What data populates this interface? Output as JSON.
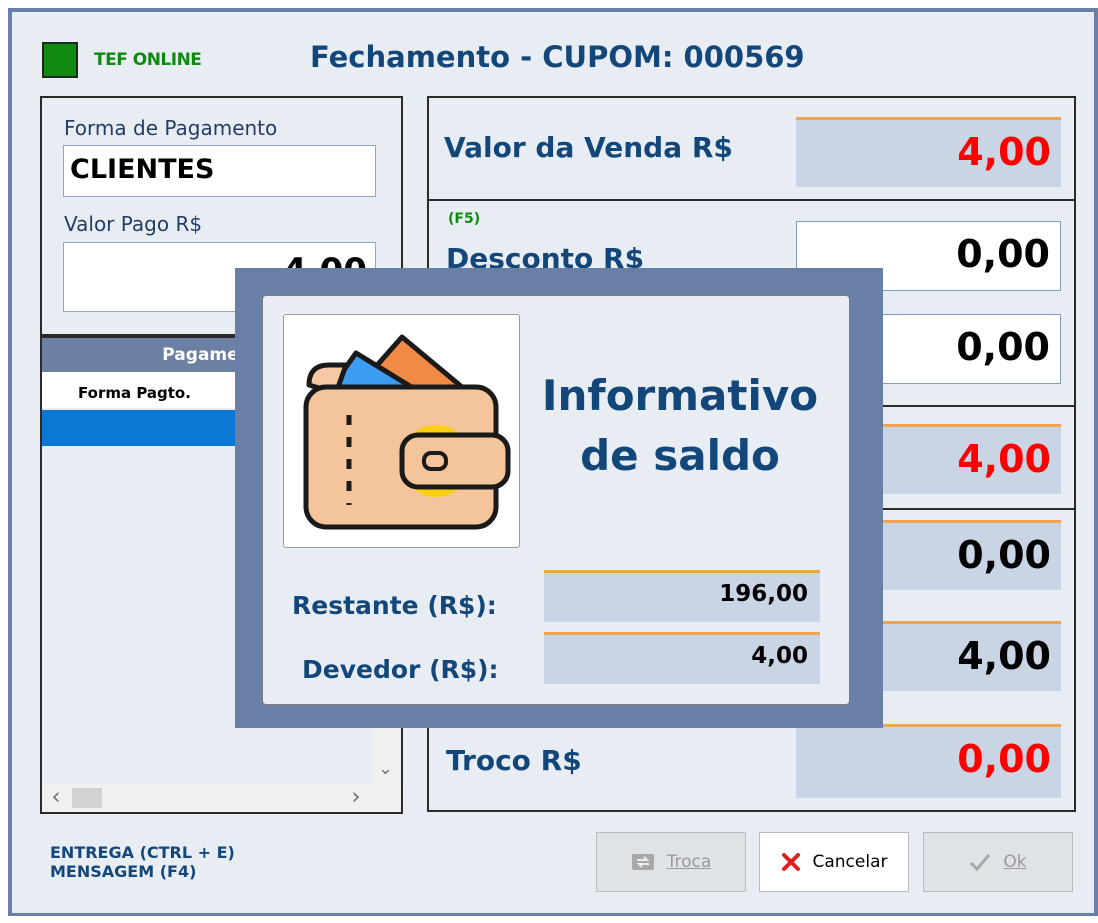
{
  "header": {
    "tef_status": "TEF ONLINE",
    "title": "Fechamento - CUPOM: 000569",
    "tef_color": "#108a10"
  },
  "left_panel": {
    "forma_label": "Forma de Pagamento",
    "forma_value": "CLIENTES",
    "valor_label": "Valor Pago R$",
    "valor_value": "4,00"
  },
  "payments_grid": {
    "header": "Pagamentos",
    "columns": [
      "Forma Pagto."
    ],
    "rows": [
      ""
    ],
    "scroll_left": "‹",
    "scroll_right": "›",
    "scroll_down": "⌄"
  },
  "right_panel": {
    "valor_venda": {
      "label": "Valor da Venda R$",
      "value": "4,00"
    },
    "desconto": {
      "hint": "(F5)",
      "label": "Desconto R$",
      "value": "0,00"
    },
    "acrescimo": {
      "value": "0,00"
    },
    "total": {
      "value": "4,00"
    },
    "pago": {
      "value": "0,00"
    },
    "falta": {
      "value": "4,00"
    },
    "troco": {
      "label": "Troco R$",
      "value": "0,00"
    }
  },
  "footer": {
    "entrega": "ENTREGA (CTRL + E)",
    "mensagem": "MENSAGEM (F4)",
    "troca_label": "Troca",
    "cancelar_label": "Cancelar",
    "ok_label": "Ok"
  },
  "modal": {
    "title_line1": "Informativo",
    "title_line2": "de saldo",
    "restante_label": "Restante (R$):",
    "restante_value": "196,00",
    "devedor_label": "Devedor (R$):",
    "devedor_value": "4,00",
    "icon": "wallet-icon"
  },
  "colors": {
    "accent": "#13477a",
    "red": "#ff0000",
    "frame": "#6a7fa6",
    "highlight": "#f0a44f"
  }
}
